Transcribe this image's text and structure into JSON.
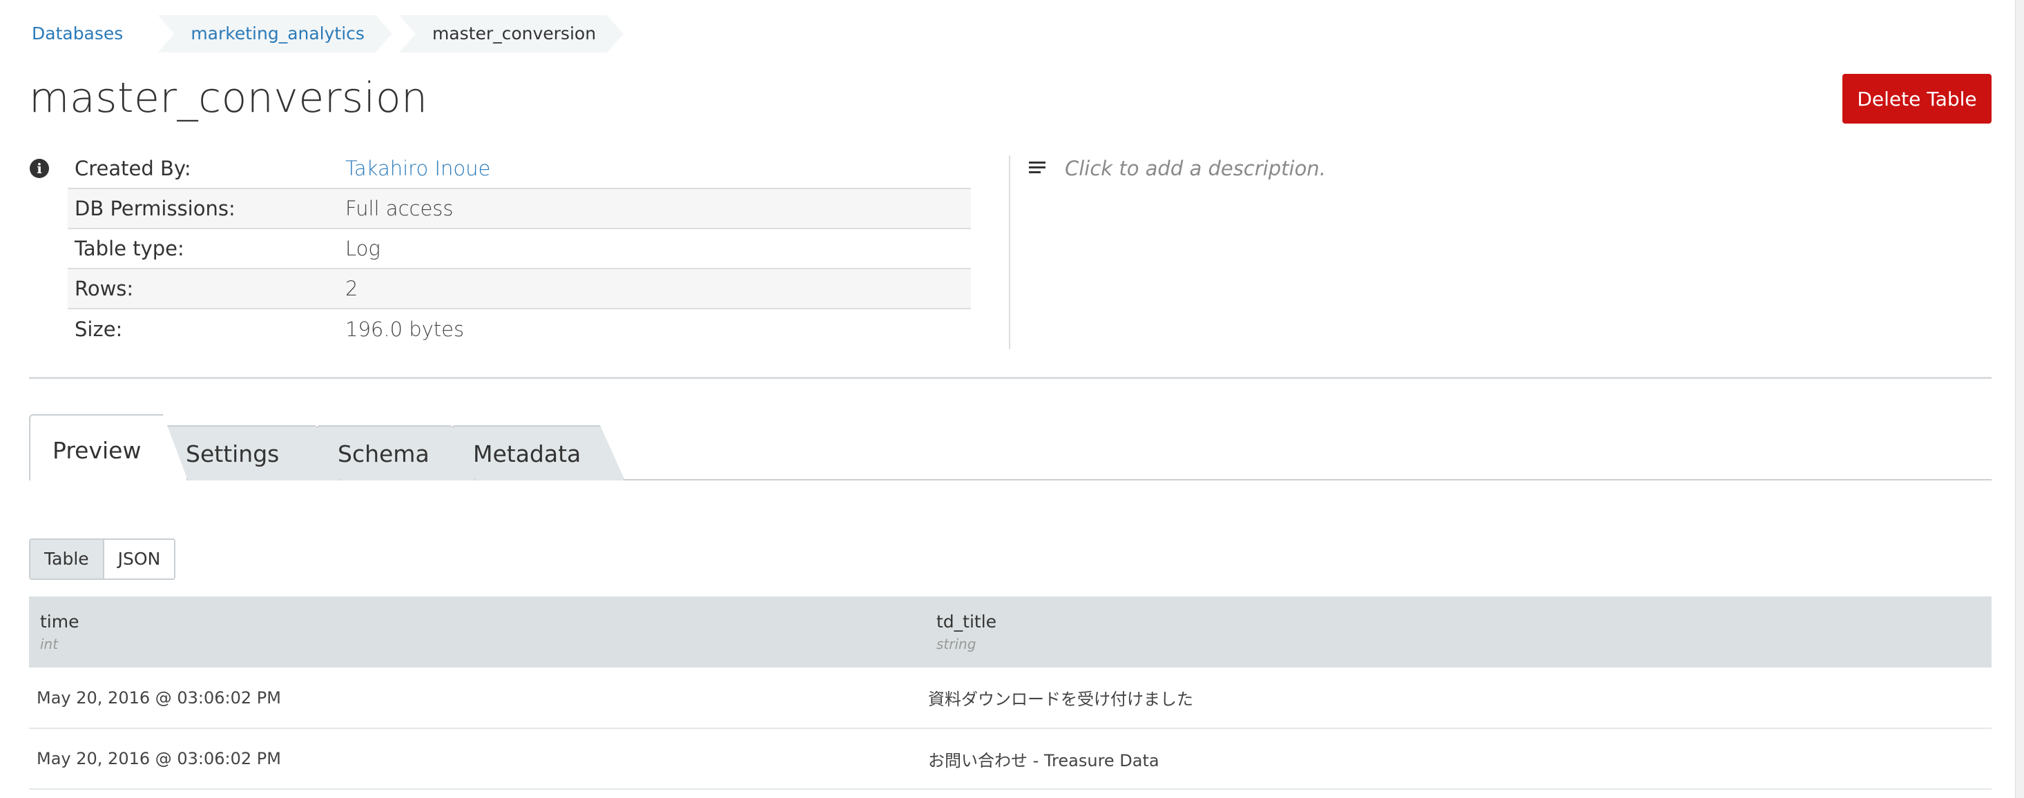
{
  "breadcrumb": {
    "items": [
      {
        "label": "Databases"
      },
      {
        "label": "marketing_analytics"
      },
      {
        "label": "master_conversion"
      }
    ]
  },
  "page": {
    "title": "master_conversion",
    "delete_label": "Delete Table"
  },
  "info": {
    "rows": [
      {
        "label": "Created By:",
        "value": "Takahiro Inoue"
      },
      {
        "label": "DB Permissions:",
        "value": "Full access"
      },
      {
        "label": "Table type:",
        "value": "Log"
      },
      {
        "label": "Rows:",
        "value": "2"
      },
      {
        "label": "Size:",
        "value": "196.0 bytes"
      }
    ],
    "description_placeholder": "Click to add a description."
  },
  "tabs": [
    {
      "label": "Preview",
      "active": true
    },
    {
      "label": "Settings"
    },
    {
      "label": "Schema"
    },
    {
      "label": "Metadata"
    }
  ],
  "view_toggle": {
    "table_label": "Table",
    "json_label": "JSON",
    "selected": "Table"
  },
  "preview": {
    "columns": [
      {
        "name": "time",
        "type": "int"
      },
      {
        "name": "td_title",
        "type": "string"
      }
    ],
    "rows": [
      [
        "May 20, 2016 @ 03:06:02 PM",
        "資料ダウンロードを受け付けました"
      ],
      [
        "May 20, 2016 @ 03:06:02 PM",
        "お問い合わせ - Treasure Data"
      ]
    ]
  },
  "colors": {
    "link": "#2a7ab9",
    "danger": "#cc1111",
    "header_bg": "#dbe1e2"
  }
}
